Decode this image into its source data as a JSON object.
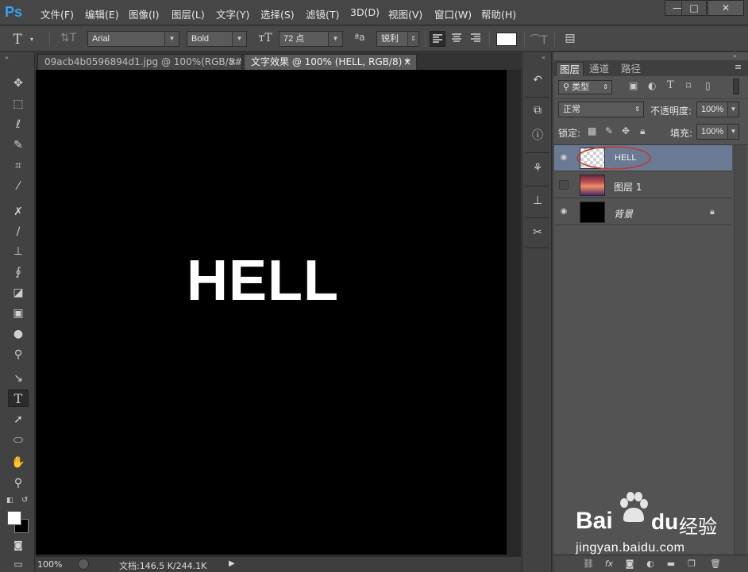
{
  "app": {
    "logo": "Ps"
  },
  "menu": [
    "文件(F)",
    "编辑(E)",
    "图像(I)",
    "图层(L)",
    "文字(Y)",
    "选择(S)",
    "滤镜(T)",
    "3D(D)",
    "视图(V)",
    "窗口(W)",
    "帮助(H)"
  ],
  "window_controls": {
    "minimize": "—",
    "maximize": "□",
    "close": "✕"
  },
  "options": {
    "font_family": "Arial",
    "font_style": "Bold",
    "font_size": "72 点",
    "aa_icon": "ªa",
    "antialias": "锐利",
    "text_color": "#ffffff"
  },
  "tabs": [
    {
      "label": "09acb4b0596894d1.jpg @ 100%(RGB/8#)",
      "close": "×"
    },
    {
      "label": "文字效果 @ 100% (HELL, RGB/8) *",
      "close": "×"
    }
  ],
  "canvas": {
    "text": "HELL"
  },
  "status": {
    "zoom": "100%",
    "doc": "文档:146.5 K/244.1K"
  },
  "panel": {
    "tabs": [
      "图层",
      "通道",
      "路径"
    ],
    "filter_kind": "类型",
    "blend_mode": "正常",
    "opacity_label": "不透明度:",
    "opacity_value": "100%",
    "lock_label": "锁定:",
    "fill_label": "填充:",
    "fill_value": "100%",
    "layers": [
      {
        "name": "HELL",
        "visible": true,
        "selected": true,
        "thumb": "checker"
      },
      {
        "name": "图层 1",
        "visible": false,
        "selected": false,
        "thumb": "sunset"
      },
      {
        "name": "背景",
        "visible": true,
        "selected": false,
        "thumb": "black",
        "locked": true
      }
    ]
  },
  "watermark": {
    "text": "jingyan.baidu.com",
    "brand": "Bai",
    "brand2": "du",
    "brand3": "经验"
  },
  "colors": {
    "accent": "#3aa1f0",
    "selected_layer": "#6a7a94",
    "highlight_ellipse": "#c0392b"
  }
}
